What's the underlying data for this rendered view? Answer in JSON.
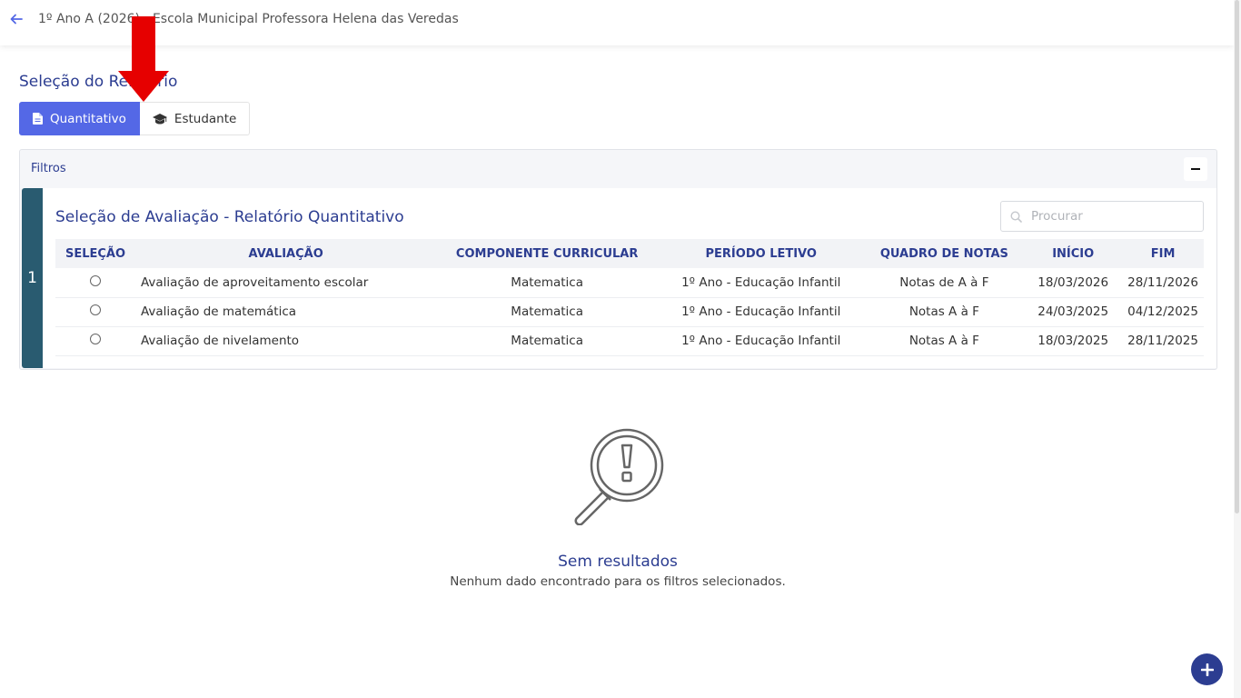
{
  "header": {
    "breadcrumb": "1º Ano A (2026) - Escola Municipal Professora Helena das Veredas"
  },
  "page": {
    "title": "Seleção do Relatório"
  },
  "report_toggle": {
    "options": [
      {
        "label": "Quantitativo",
        "icon": "file-icon",
        "active": true
      },
      {
        "label": "Estudante",
        "icon": "graduation-cap-icon",
        "active": false
      }
    ]
  },
  "filters": {
    "title": "Filtros",
    "step_number": "1",
    "card_title": "Seleção de Avaliação - Relatório Quantitativo",
    "search_placeholder": "Procurar",
    "columns": [
      "SELEÇÃO",
      "AVALIAÇÃO",
      "COMPONENTE CURRICULAR",
      "PERÍODO LETIVO",
      "QUADRO DE NOTAS",
      "INÍCIO",
      "FIM"
    ],
    "rows": [
      {
        "avaliacao": "Avaliação de aproveitamento escolar",
        "componente": "Matematica",
        "periodo": "1º Ano - Educação Infantil",
        "quadro": "Notas de A à F",
        "inicio": "18/03/2026",
        "fim": "28/11/2026"
      },
      {
        "avaliacao": "Avaliação de matemática",
        "componente": "Matematica",
        "periodo": "1º Ano - Educação Infantil",
        "quadro": "Notas A à F",
        "inicio": "24/03/2025",
        "fim": "04/12/2025"
      },
      {
        "avaliacao": "Avaliação de nivelamento",
        "componente": "Matematica",
        "periodo": "1º Ano - Educação Infantil",
        "quadro": "Notas A à F",
        "inicio": "18/03/2025",
        "fim": "28/11/2025"
      }
    ]
  },
  "empty_state": {
    "title": "Sem resultados",
    "subtitle": "Nenhum dado encontrado para os filtros selecionados."
  },
  "colors": {
    "primary": "#5468e6",
    "navy": "#2c3d91",
    "step": "#295b70",
    "annotation_arrow": "#e60000"
  }
}
